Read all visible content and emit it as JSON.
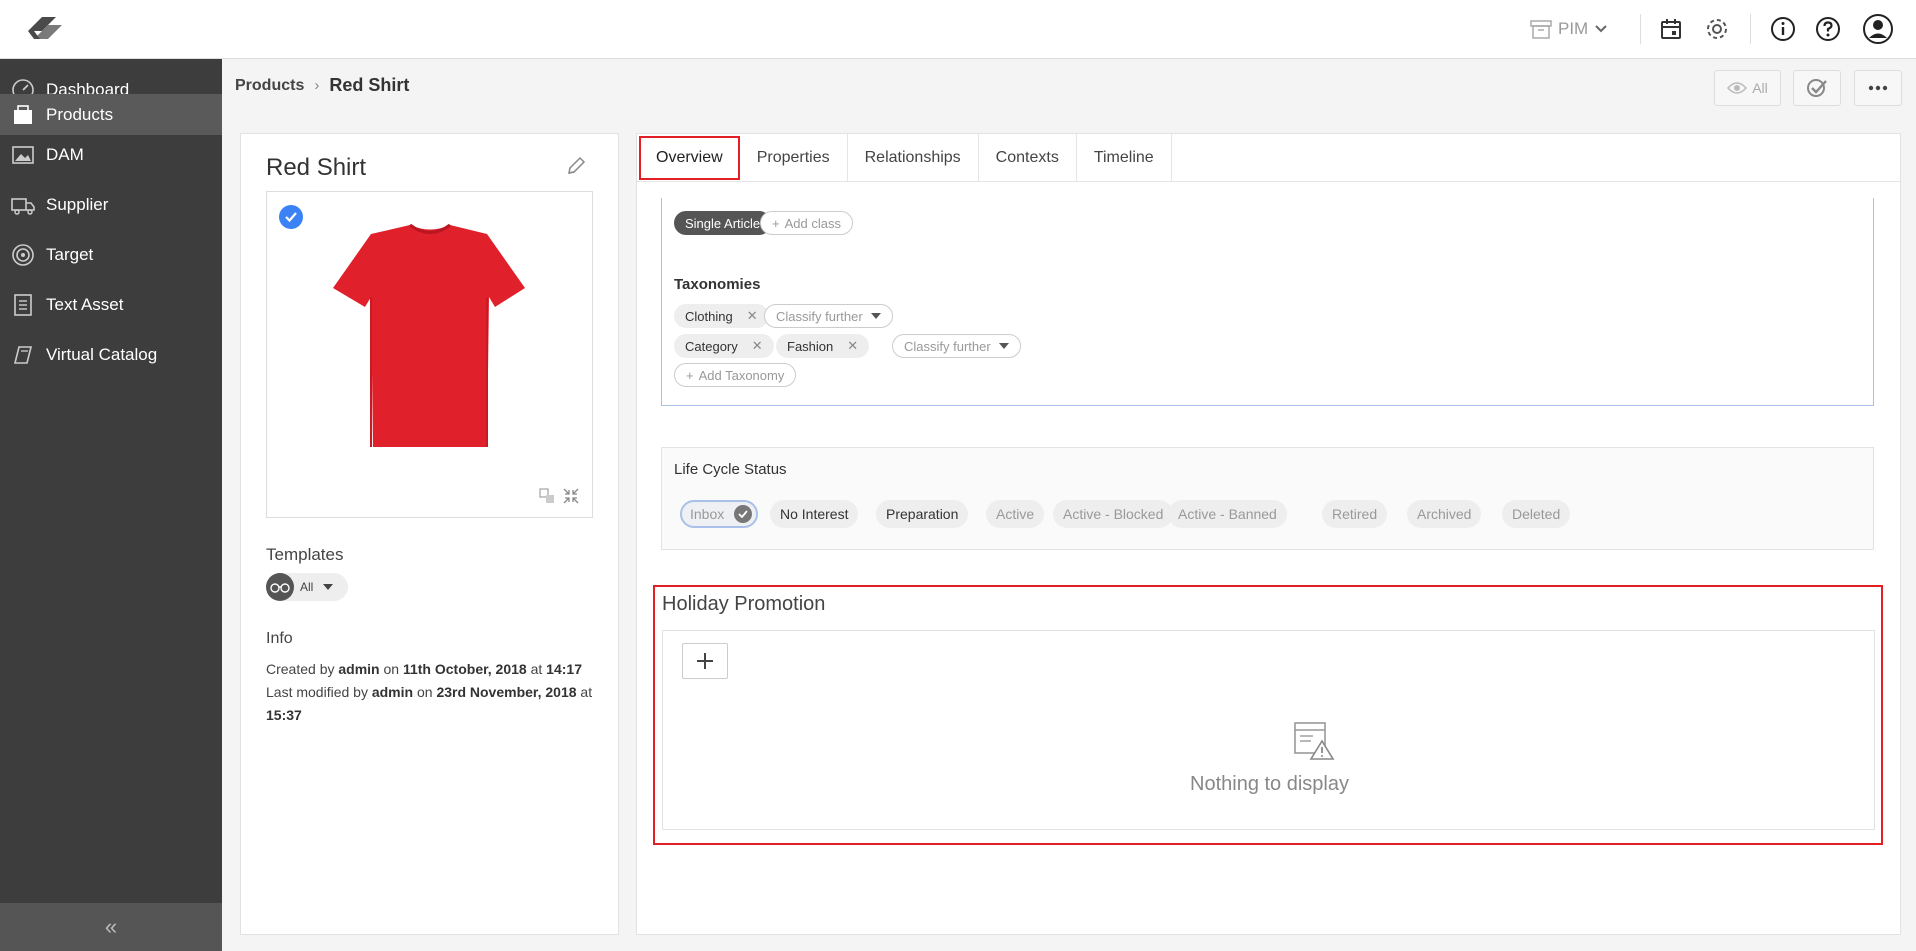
{
  "topbar": {
    "module": "PIM"
  },
  "sidebar": {
    "items": [
      {
        "label": "Dashboard"
      },
      {
        "label": "Products"
      },
      {
        "label": "DAM"
      },
      {
        "label": "Supplier"
      },
      {
        "label": "Target"
      },
      {
        "label": "Text Asset"
      },
      {
        "label": "Virtual Catalog"
      }
    ],
    "collapse_glyph": "«"
  },
  "breadcrumb": {
    "parent": "Products",
    "separator": "›",
    "current": "Red Shirt"
  },
  "header_actions": {
    "view_label": "All"
  },
  "product": {
    "title": "Red Shirt",
    "templates_label": "Templates",
    "template_value": "All",
    "info_label": "Info",
    "created_prefix": "Created by",
    "created_user": "admin",
    "created_on": "on",
    "created_date": "11th October, 2018",
    "created_at": "at",
    "created_time": "14:17",
    "modified_prefix": "Last modified by",
    "modified_user": "admin",
    "modified_on": "on",
    "modified_date": "23rd November, 2018",
    "modified_at": "at",
    "modified_time": "15:37"
  },
  "tabs": [
    "Overview",
    "Properties",
    "Relationships",
    "Contexts",
    "Timeline"
  ],
  "classification": {
    "class_chip": "Single Article",
    "add_class": "Add class",
    "taxonomies_label": "Taxonomies",
    "row1": {
      "chip": "Clothing",
      "classify": "Classify further"
    },
    "row2": {
      "chip1": "Category",
      "chip2": "Fashion",
      "classify": "Classify further"
    },
    "add_taxonomy": "Add Taxonomy"
  },
  "lifecycle": {
    "label": "Life Cycle Status",
    "statuses": [
      "Inbox",
      "No Interest",
      "Preparation",
      "Active",
      "Active - Blocked",
      "Active - Banned",
      "Retired",
      "Archived",
      "Deleted"
    ]
  },
  "promotion": {
    "title": "Holiday Promotion",
    "empty_text": "Nothing to display"
  },
  "colors": {
    "accent_red": "#e31e24",
    "sidebar_bg": "#3d3d3d",
    "check_blue": "#3b82f6"
  }
}
